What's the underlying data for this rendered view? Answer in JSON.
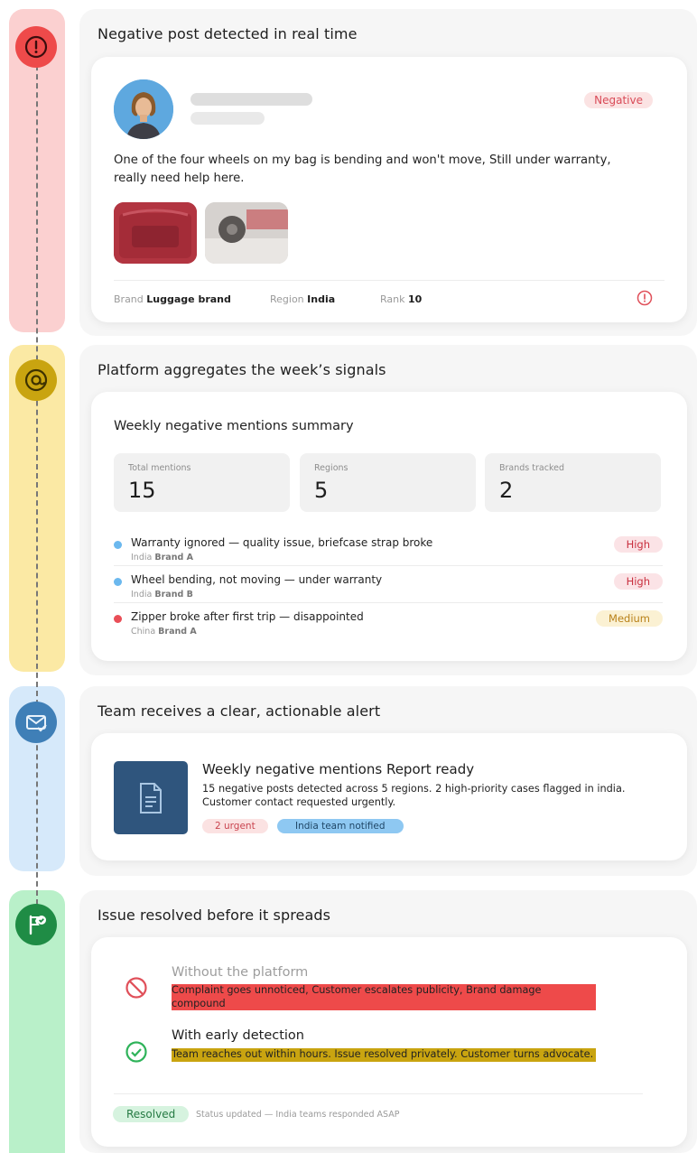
{
  "colors": {
    "step1_rail": "#fbd0d0",
    "step2_rail": "#fbe9a4",
    "step3_rail": "#d6e9fa",
    "step4_rail": "#b9f0c9",
    "negative": "#d94b58",
    "high": "#c9303f",
    "medium": "#b9821a",
    "resolved": "#257a43"
  },
  "steps": [
    {
      "icon": "alert-circle-icon",
      "title": "Negative post detected in real time"
    },
    {
      "icon": "at-sign-icon",
      "title": "Platform aggregates the week’s signals"
    },
    {
      "icon": "mail-check-icon",
      "title": "Team receives a clear, actionable alert"
    },
    {
      "icon": "flag-check-icon",
      "title": "Issue resolved before it spreads"
    }
  ],
  "post": {
    "sentiment": "Negative",
    "text": "One of the four wheels on my bag is bending and won't move, Still under warranty, really need help here.",
    "meta": {
      "brand_label": "Brand",
      "brand_value": "Luggage brand",
      "region_label": "Region",
      "region_value": "India",
      "rank_label": "Rank",
      "rank_value": "10"
    }
  },
  "summary": {
    "title": "Weekly negative mentions summary",
    "stats": [
      {
        "label": "Total mentions",
        "value": "15"
      },
      {
        "label": "Regions",
        "value": "5"
      },
      {
        "label": "Brands tracked",
        "value": "2"
      }
    ],
    "mentions": [
      {
        "text": "Warranty ignored — quality issue, briefcase strap broke",
        "region": "India",
        "brand": "Brand A",
        "severity": "High",
        "dot_color": "#6bb8ee"
      },
      {
        "text": "Wheel bending, not moving — under warranty",
        "region": "India",
        "brand": "Brand B",
        "severity": "High",
        "dot_color": "#6bb8ee"
      },
      {
        "text": "Zipper broke after first trip — disappointed",
        "region": "China",
        "brand": "Brand A",
        "severity": "Medium",
        "dot_color": "#e94e57"
      }
    ]
  },
  "alert": {
    "title": "Weekly negative mentions Report ready",
    "body": "15 negative posts detected across 5 regions. 2 high-priority cases flagged in india. Customer contact requested urgently.",
    "tags": [
      "2 urgent",
      "India team notified"
    ]
  },
  "resolution": {
    "without_title": "Without the platform",
    "without_body": "Complaint goes unnoticed, Customer escalates publicity, Brand damage compound",
    "with_title": "With early detection",
    "with_body": "Team reaches out within hours. Issue resolved privately. Customer turns advocate.",
    "status_badge": "Resolved",
    "status_text": "Status updated — India teams responded ASAP"
  }
}
